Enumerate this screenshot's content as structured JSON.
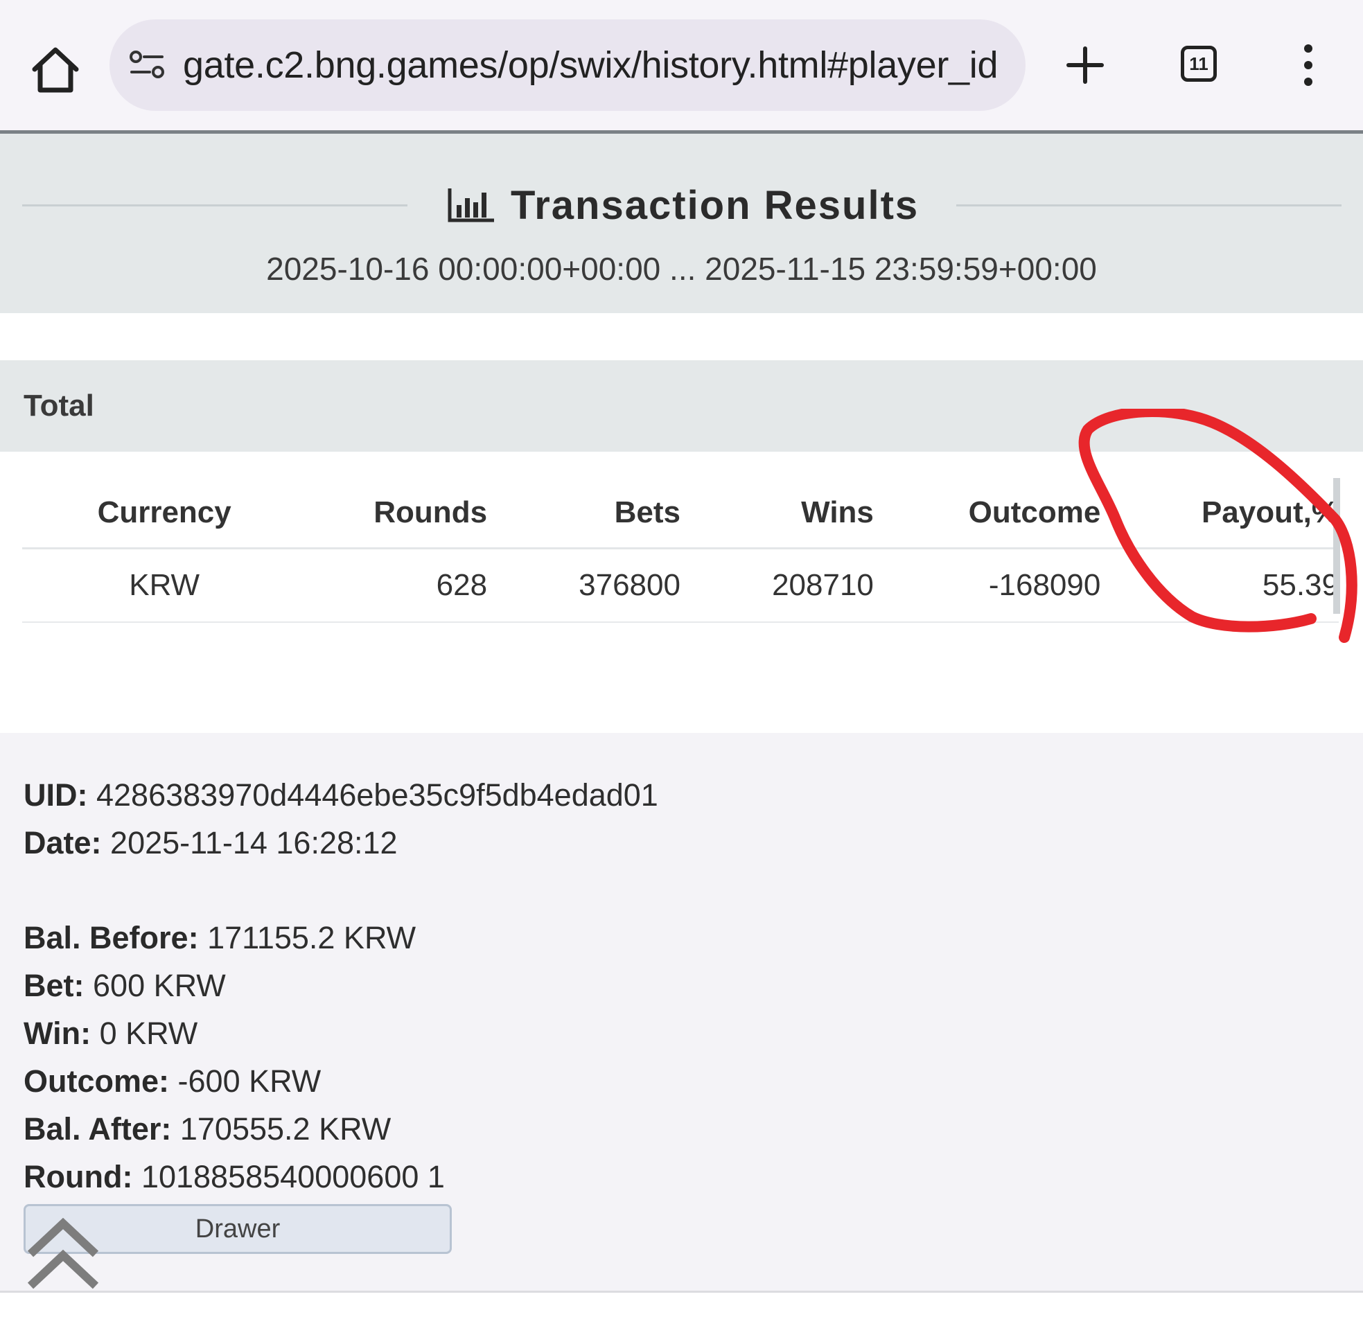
{
  "browser": {
    "url": "gate.c2.bng.games/op/swix/history.html#player_id",
    "tab_count": "11",
    "icons": [
      "home-icon",
      "site-settings-icon",
      "plus-icon",
      "tabs-icon",
      "more-vert-icon"
    ]
  },
  "header": {
    "title": "Transaction Results",
    "date_range": "2025-10-16 00:00:00+00:00 ... 2025-11-15 23:59:59+00:00",
    "icon": "bar-chart-icon"
  },
  "total": {
    "label": "Total",
    "columns": [
      "Currency",
      "Rounds",
      "Bets",
      "Wins",
      "Outcome",
      "Payout,%"
    ],
    "rows": [
      [
        "KRW",
        "628",
        "376800",
        "208710",
        "-168090",
        "55.39"
      ]
    ]
  },
  "transaction": {
    "uid_label": "UID:",
    "uid": "4286383970d4446ebe35c9f5db4edad01",
    "date_label": "Date:",
    "date": "2025-11-14 16:28:12",
    "bal_before_label": "Bal. Before:",
    "bal_before": "171155.2 KRW",
    "bet_label": "Bet:",
    "bet": "600 KRW",
    "win_label": "Win:",
    "win": "0 KRW",
    "outcome_label": "Outcome:",
    "outcome": "-600 KRW",
    "bal_after_label": "Bal. After:",
    "bal_after": "170555.2 KRW",
    "round_label": "Round:",
    "round": "1018858540000600 1",
    "drawer_label": "Drawer"
  },
  "colors": {
    "header_bg": "#e4e8e9",
    "detail_bg": "#f4f3f7",
    "annotation": "#e8262b"
  }
}
